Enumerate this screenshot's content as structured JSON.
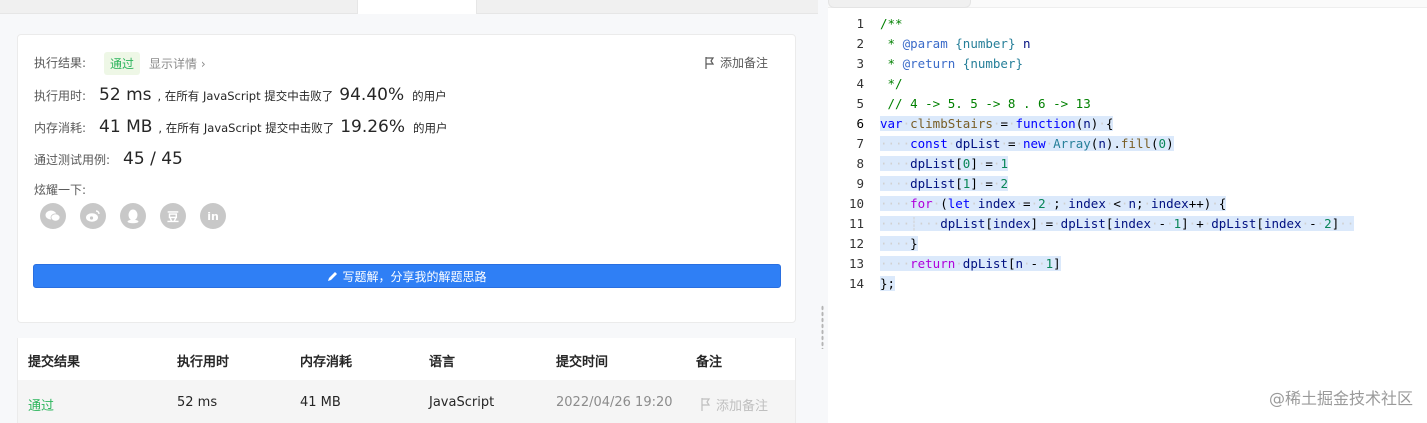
{
  "result": {
    "status_label": "执行结果:",
    "status_value": "通过",
    "detail_link": "显示详情 ›",
    "add_note": "添加备注",
    "runtime": {
      "label": "执行用时:",
      "value": "52 ms",
      "text": ", 在所有 JavaScript 提交中击败了",
      "percent": "94.40%",
      "suffix": "的用户"
    },
    "memory": {
      "label": "内存消耗:",
      "value": "41 MB",
      "text": ", 在所有 JavaScript 提交中击败了",
      "percent": "19.26%",
      "suffix": "的用户"
    },
    "testcases": {
      "label": "通过测试用例:",
      "value": "45 / 45"
    },
    "share_label": "炫耀一下:",
    "share_icons": [
      "wechat-icon",
      "weibo-icon",
      "qq-icon",
      "douban-icon",
      "linkedin-icon"
    ],
    "share_glyphs": {
      "douban": "豆",
      "linkedin": "in"
    },
    "write_button": "写题解，分享我的解题思路"
  },
  "table": {
    "headers": [
      "提交结果",
      "执行用时",
      "内存消耗",
      "语言",
      "提交时间",
      "备注"
    ],
    "rows": [
      {
        "result": "通过",
        "runtime": "52 ms",
        "memory": "41 MB",
        "language": "JavaScript",
        "time": "2022/04/26 19:20",
        "note": "添加备注"
      }
    ]
  },
  "editor": {
    "current_line": 6,
    "line_numbers": [
      "1",
      "2",
      "3",
      "4",
      "5",
      "6",
      "7",
      "8",
      "9",
      "10",
      "11",
      "12",
      "13",
      "14"
    ]
  },
  "watermark": "@稀土掘金技术社区",
  "colors": {
    "accent": "#2f7ff5",
    "pass": "#2db55d",
    "selection": "#dbe9fb"
  }
}
